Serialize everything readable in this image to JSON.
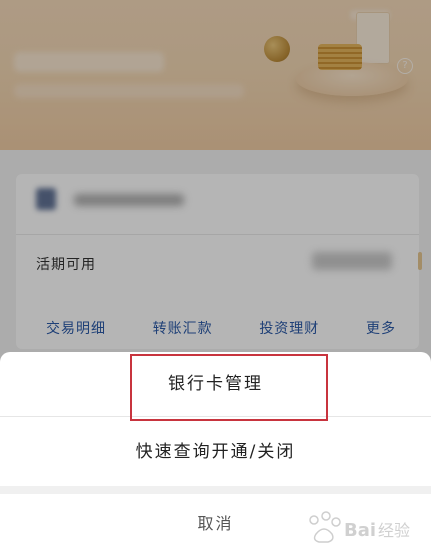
{
  "account_card": {
    "available_label": "活期可用",
    "quick_links": [
      "交易明细",
      "转账汇款",
      "投资理财",
      "更多"
    ]
  },
  "action_sheet": {
    "options": [
      "银行卡管理",
      "快速查询开通/关闭"
    ],
    "cancel_label": "取消",
    "highlighted_option_index": 0
  },
  "icons": {
    "help": "question-icon"
  },
  "watermark": {
    "text": "Baidu经验"
  },
  "colors": {
    "link": "#2b59a6",
    "highlight": "#c8343e",
    "banner": "#efd4b1"
  }
}
